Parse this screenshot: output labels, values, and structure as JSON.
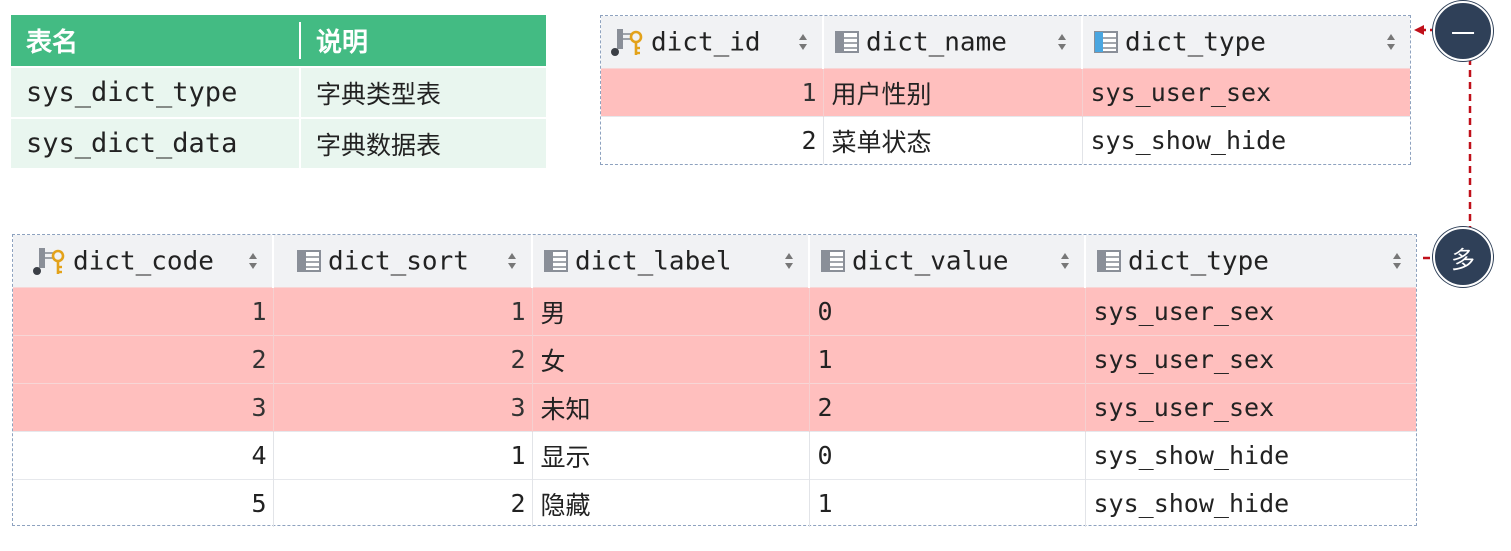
{
  "legend": {
    "headers": [
      "表名",
      "说明"
    ],
    "rows": [
      {
        "name": "sys_dict_type",
        "desc": "字典类型表"
      },
      {
        "name": "sys_dict_data",
        "desc": "字典数据表"
      }
    ]
  },
  "dict_type_table": {
    "columns": [
      "dict_id",
      "dict_name",
      "dict_type"
    ],
    "rows": [
      {
        "dict_id": "1",
        "dict_name": "用户性别",
        "dict_type": "sys_user_sex",
        "highlight": true
      },
      {
        "dict_id": "2",
        "dict_name": "菜单状态",
        "dict_type": "sys_show_hide",
        "highlight": false
      }
    ]
  },
  "dict_data_table": {
    "columns": [
      "dict_code",
      "dict_sort",
      "dict_label",
      "dict_value",
      "dict_type"
    ],
    "rows": [
      {
        "dict_code": "1",
        "dict_sort": "1",
        "dict_label": "男",
        "dict_value": "0",
        "dict_type": "sys_user_sex",
        "highlight": true
      },
      {
        "dict_code": "2",
        "dict_sort": "2",
        "dict_label": "女",
        "dict_value": "1",
        "dict_type": "sys_user_sex",
        "highlight": true
      },
      {
        "dict_code": "3",
        "dict_sort": "3",
        "dict_label": "未知",
        "dict_value": "2",
        "dict_type": "sys_user_sex",
        "highlight": true
      },
      {
        "dict_code": "4",
        "dict_sort": "1",
        "dict_label": "显示",
        "dict_value": "0",
        "dict_type": "sys_show_hide",
        "highlight": false
      },
      {
        "dict_code": "5",
        "dict_sort": "2",
        "dict_label": "隐藏",
        "dict_value": "1",
        "dict_type": "sys_show_hide",
        "highlight": false
      }
    ]
  },
  "relation": {
    "one": "一",
    "many": "多"
  },
  "colors": {
    "legend_header": "#43bb83",
    "legend_body": "#e9f6ef",
    "highlight_row": "#ffbfbe",
    "badge": "#2f4058",
    "connector": "#c0101a",
    "grid_border": "#8ea2bf"
  },
  "icons": {
    "primary_key_column": "key-column-icon",
    "column": "column-icon",
    "indexed_column": "indexed-column-icon",
    "sort": "sort-icon"
  }
}
